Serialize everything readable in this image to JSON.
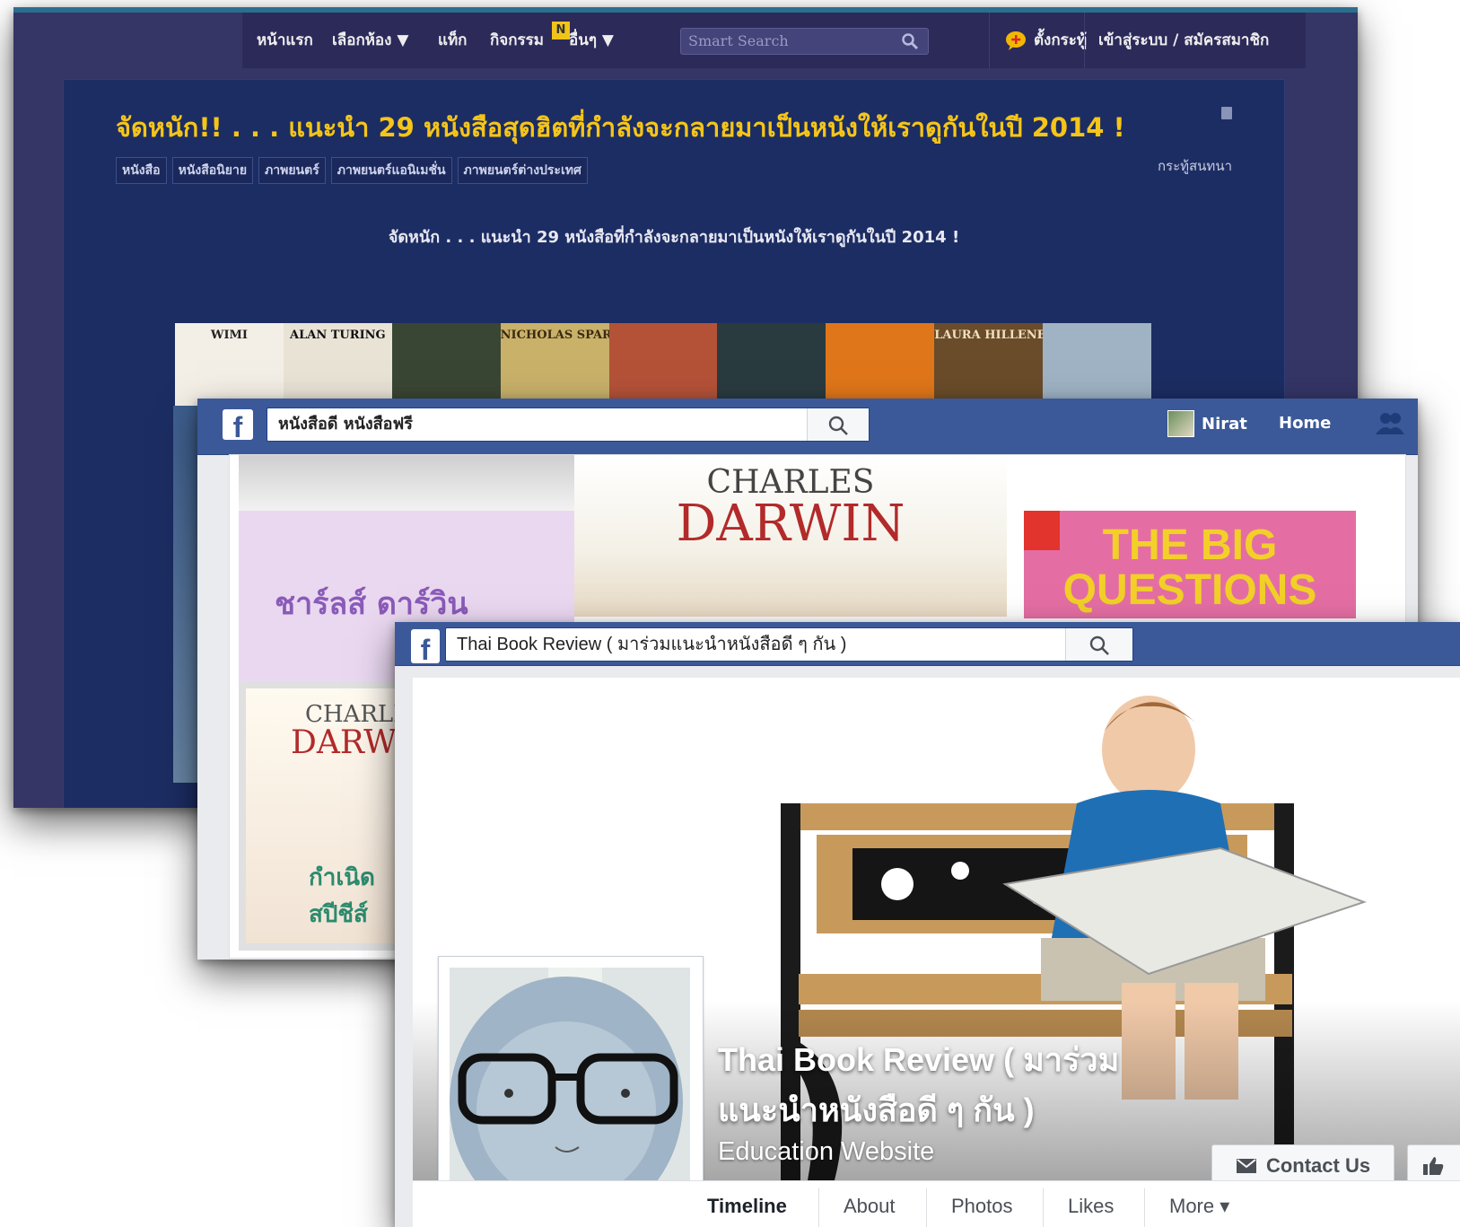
{
  "pantip": {
    "nav": [
      "หน้าแรก",
      "เลือกห้อง ▼",
      "แท็ก",
      "กิจกรรม",
      "อื่นๆ ▼"
    ],
    "activity_badge": "N",
    "search_placeholder": "Smart Search",
    "new_topic": "ตั้งกระทู้",
    "login": "เข้าสู่ระบบ / สมัครสมาชิก",
    "post_title": "จัดหนัก!! . . . แนะนำ 29 หนังสือสุดฮิตที่กำลังจะกลายมาเป็นหนังให้เราดูกันในปี 2014 !",
    "tags": [
      "หนังสือ",
      "หนังสือนิยาย",
      "ภาพยนตร์",
      "ภาพยนตร์แอนิเมชั่น",
      "ภาพยนตร์ต่างประเทศ"
    ],
    "chat_label": "กระทู้สนทนา",
    "post_subtitle": "จัดหนัก . . . แนะนำ 29 หนังสือที่กำลังจะกลายมาเป็นหนังให้เราดูกันในปี 2014 !",
    "covers": [
      {
        "text": "WIMI",
        "bg": "#f4efe6",
        "fg": "#222222"
      },
      {
        "text": "ALAN TURING",
        "bg": "#e9e3d6",
        "fg": "#111111"
      },
      {
        "text": "",
        "bg": "#3a4634",
        "fg": "#ffffff"
      },
      {
        "text": "NICHOLAS SPARKS",
        "bg": "#c9b16a",
        "fg": "#3a2a10"
      },
      {
        "text": "",
        "bg": "#b45238",
        "fg": "#ffffff"
      },
      {
        "text": "",
        "bg": "#2a3b40",
        "fg": "#ffffff"
      },
      {
        "text": "",
        "bg": "#e0761a",
        "fg": "#ffffff"
      },
      {
        "text": "LAURA HILLENBRAND",
        "bg": "#6a4c2a",
        "fg": "#f0e0c0"
      },
      {
        "text": "",
        "bg": "#9fb3c4",
        "fg": "#ffffff"
      }
    ]
  },
  "fb_darwin": {
    "search_text": "หนังสือดี หนังสือฟรี",
    "user_name": "Nirat",
    "home": "Home",
    "darwin_title_1": "CHARLES",
    "darwin_title_2": "DARWIN",
    "thai_name": "ชาร์ลส์ ดาร์วิน",
    "big_questions_1": "THE BIG",
    "big_questions_2": "QUESTIONS",
    "small_book_1": "CHARLE",
    "small_book_2": "DARW",
    "small_book_thai": "กำเนิด สปีชีส์"
  },
  "fb_tbr": {
    "search_text": "Thai Book Review ( มาร่วมแนะนำหนังสือดี ๆ กัน )",
    "page_name_line1": "Thai Book Review ( มาร่วม",
    "page_name_line2": "แนะนำหนังสือดี ๆ กัน )",
    "category": "Education Website",
    "contact_button": "Contact Us",
    "tabs": [
      "Timeline",
      "About",
      "Photos",
      "Likes",
      "More ▾"
    ]
  }
}
